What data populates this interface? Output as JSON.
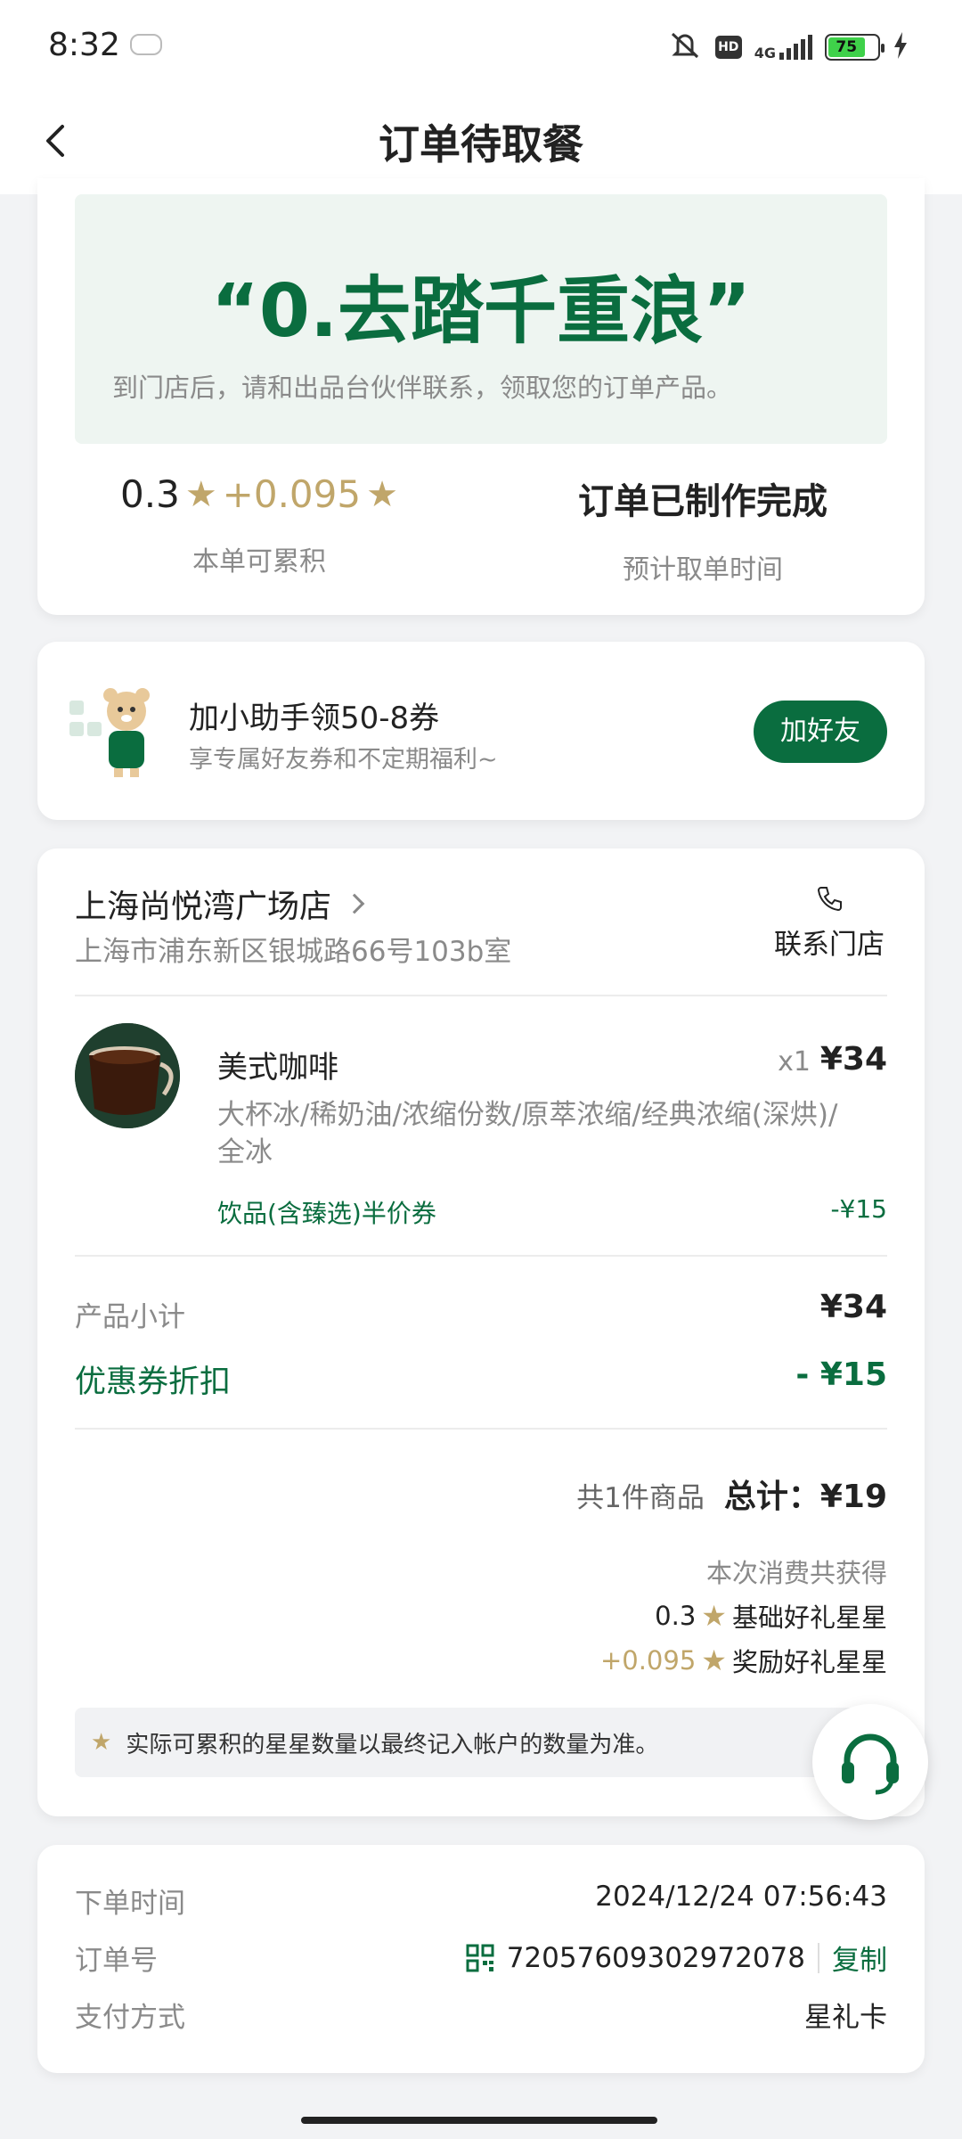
{
  "status_bar": {
    "time": "8:32",
    "network": "4G",
    "hd": "HD",
    "battery": "75",
    "icons": [
      "mute-icon",
      "hd-icon",
      "signal-icon",
      "battery-icon",
      "charging-icon"
    ]
  },
  "header": {
    "title": "订单待取餐"
  },
  "pickup": {
    "code": "“0.去踏千重浪”",
    "hint": "到门店后，请和出品台伙伴联系，领取您的订单产品。",
    "stars_base": "0.3",
    "stars_bonus": "+0.095",
    "stars_label": "本单可累积",
    "status": "订单已制作完成",
    "status_label": "预计取单时间"
  },
  "promo": {
    "title": "加小助手领50-8券",
    "subtitle": "享专属好友券和不定期福利~",
    "button": "加好友"
  },
  "store": {
    "name": "上海尚悦湾广场店",
    "address": "上海市浦东新区银城路66号103b室",
    "contact_label": "联系门店"
  },
  "product": {
    "name": "美式咖啡",
    "qty": "x1",
    "price": "¥34",
    "spec": "大杯冰/稀奶油/浓缩份数/原萃浓缩/经典浓缩(深烘)/全冰",
    "coupon": "饮品(含臻选)半价券",
    "coupon_amount": "-¥15"
  },
  "summary": {
    "subtotal_label": "产品小计",
    "subtotal_value": "¥34",
    "discount_label": "优惠券折扣",
    "discount_value": "- ¥15",
    "count_text": "共1件商品",
    "total_text": "总计：¥19",
    "earned_head": "本次消费共获得",
    "earned_base_value": "0.3",
    "earned_base_label": "基础好礼星星",
    "earned_bonus_value": "+0.095",
    "earned_bonus_label": "奖励好礼星星",
    "note": "实际可累积的星星数量以最终记入帐户的数量为准。"
  },
  "meta": {
    "order_time_label": "下单时间",
    "order_time_value": "2024/12/24 07:56:43",
    "order_no_label": "订单号",
    "order_no_value": "72057609302972078",
    "copy_label": "复制",
    "payment_label": "支付方式",
    "payment_value": "星礼卡"
  },
  "colors": {
    "brand_green": "#0a6d3f",
    "star_gold": "#c0a66a",
    "pickup_bg": "#eef5f1"
  }
}
